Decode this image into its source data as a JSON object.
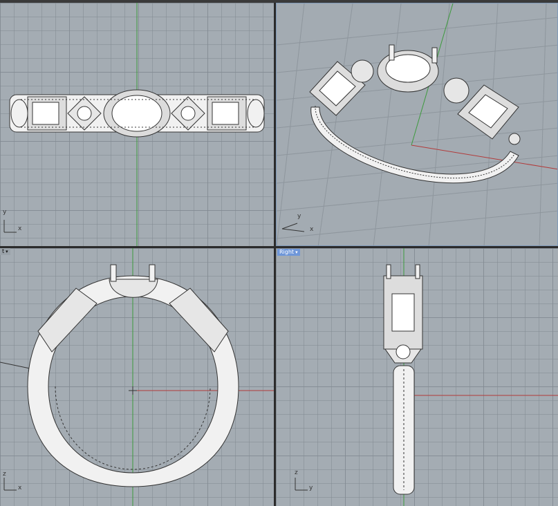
{
  "viewports": {
    "top": {
      "label": "",
      "axes": {
        "a": "y",
        "b": "x"
      }
    },
    "perspective": {
      "label": "",
      "axes": {
        "a": "y",
        "b": "x"
      }
    },
    "front": {
      "label": "t",
      "axes": {
        "a": "z",
        "b": "x"
      }
    },
    "right": {
      "label": "Right",
      "axes": {
        "a": "z",
        "b": "y"
      }
    }
  },
  "colors": {
    "viewport_bg": "#a4acb3",
    "grid": "#828a92",
    "x_axis": "#b23a3a",
    "y_axis": "#3d9a3d",
    "active_tag": "#6f97d9",
    "model": "#f2f2f2",
    "wire": "#333333"
  }
}
